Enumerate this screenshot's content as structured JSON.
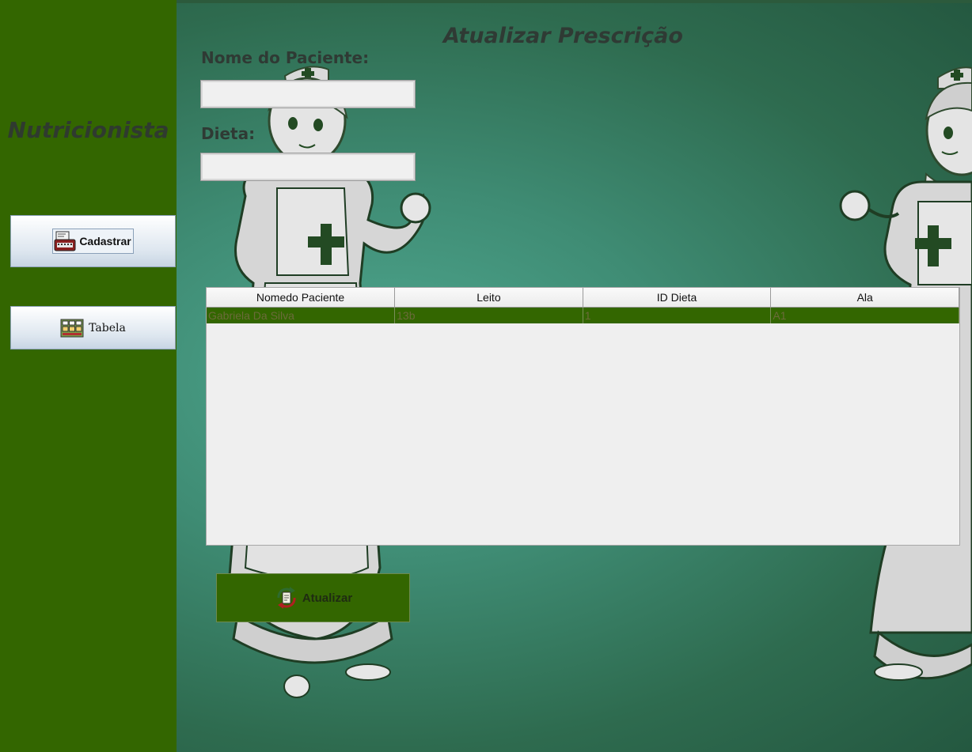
{
  "sidebar": {
    "title": "Nutricionista",
    "buttons": [
      {
        "label": "Cadastrar",
        "icon": "register-machine-icon"
      },
      {
        "label": "Tabela",
        "icon": "table-icon"
      }
    ]
  },
  "main": {
    "title": "Atualizar Prescrição",
    "fields": {
      "nome_label": "Nome do Paciente:",
      "nome_value": "",
      "dieta_label": "Dieta:",
      "dieta_value": ""
    },
    "table": {
      "columns": [
        "Nomedo Paciente",
        "Leito",
        "ID Dieta",
        "Ala"
      ],
      "rows": [
        [
          "Gabriela Da Silva",
          "13b",
          "1",
          "A1"
        ]
      ]
    },
    "update_button": {
      "label": "Atualizar",
      "icon": "update-refresh-icon"
    }
  },
  "colors": {
    "sidebar": "#336600",
    "background": "#3f8c74",
    "selected_row": "#336600",
    "title_text": "#2f3a34"
  }
}
